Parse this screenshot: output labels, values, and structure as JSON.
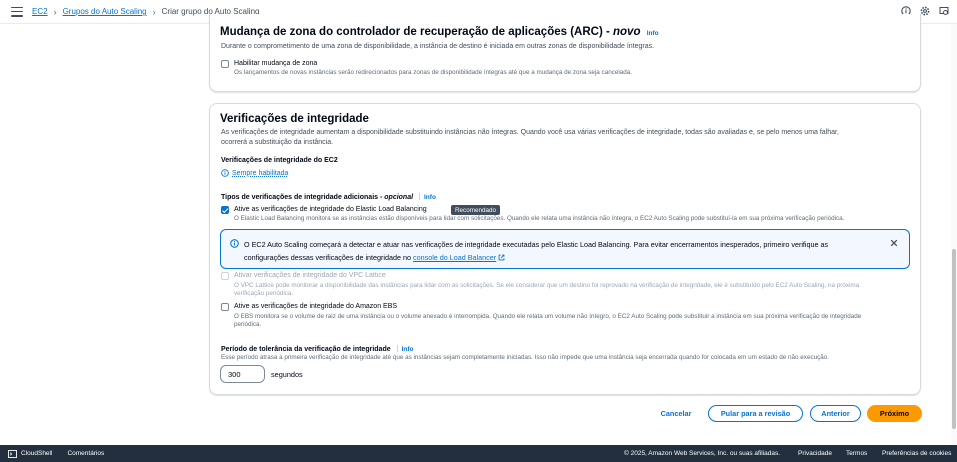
{
  "header": {
    "breadcrumbs": [
      "EC2",
      "Grupos do Auto Scaling"
    ],
    "current": "Criar grupo do Auto Scaling"
  },
  "arc": {
    "title": "Mudança de zona do controlador de recuperação de aplicações (ARC) - ",
    "title_suffix": "novo",
    "info": "Info",
    "description": "Durante o comprometimento de uma zona de disponibilidade, a instância de destino é iniciada em outras zonas de disponibilidade íntegras.",
    "checkbox_label": "Habilitar mudança de zona",
    "checkbox_checked": false,
    "checkbox_help": "Os lançamentos de novas instâncias serão redirecionados para zonas de disponibilidade íntegras até que a mudança de zona seja cancelada."
  },
  "health": {
    "title": "Verificações de integridade",
    "description_1": "As verificações de integridade aumentam a disponibilidade substituindo instâncias não íntegras. Quando você usa várias verificações de integridade, todas são avaliadas e, se pelo menos uma falhar,",
    "description_2": "ocorrerá a substituição da instância.",
    "ec2_label": "Verificações de integridade do EC2",
    "ec2_value": "Sempre habilitada",
    "extra_label": "Tipos de verificações de integridade adicionais - ",
    "extra_optional": "opcional",
    "info": "Info",
    "elb": {
      "label": "Ative as verificações de integridade do Elastic Load Balancing",
      "badge": "Recomendado",
      "checked": true,
      "help": "O Elastic Load Balancing monitora se as instâncias estão disponíveis para lidar com solicitações. Quando ele relata uma instância não íntegra, o EC2 Auto Scaling pode substituí-la em sua próxima verificação periódica."
    },
    "alert": {
      "text_1": "O EC2 Auto Scaling começará a detectar e atuar nas verificações de integridade executadas pelo Elastic Load Balancing. Para evitar encerramentos inesperados, primeiro verifique as",
      "text_2": "configurações dessas verificações de integridade no ",
      "link": "console do Load Balancer"
    },
    "vpc": {
      "label": "Ativar verificações de integridade do VPC Lattice",
      "help_1": "O VPC Lattice pode monitorar a disponibilidade das instâncias para lidar com as solicitações. Se ele considerar que um destino foi reprovado na verificação de integridade, ele é substituído pelo EC2 Auto Scaling, na próxima",
      "help_2": "verificação periódica."
    },
    "ebs": {
      "label": "Ative as verificações de integridade do Amazon EBS",
      "checked": false,
      "help_1": "O EBS monitora se o volume de raiz de uma instância ou o volume anexado é interrompida. Quando ele relata um volume não íntegro, o EC2 Auto Scaling pode substituir a instância em sua próxima verificação de integridade",
      "help_2": "periódica."
    },
    "grace": {
      "label": "Período de tolerância da verificação de integridade",
      "info": "Info",
      "help": "Esse período atrasa a primeira verificação de integridade até que as instâncias sejam completamente iniciadas. Isso não impede que uma instância seja encerrada quando for colocada em um estado de não execução.",
      "value": "300",
      "unit": "segundos"
    }
  },
  "actions": {
    "cancel": "Cancelar",
    "skip": "Pular para a revisão",
    "previous": "Anterior",
    "next": "Próximo"
  },
  "footer": {
    "cloudshell": "CloudShell",
    "feedback": "Comentários",
    "copyright": "© 2025, Amazon Web Services, Inc. ou suas afiliadas.",
    "privacy": "Privacidade",
    "terms": "Termos",
    "cookies": "Preferências de cookies"
  },
  "colors": {
    "link": "#0972d3",
    "primary": "#ff9900",
    "footer_bg": "#232f3e"
  },
  "icons": [
    "menu-icon",
    "info-circle-icon",
    "settings-icon",
    "notifications-icon",
    "clock-icon",
    "external-link-icon",
    "close-icon",
    "cloudshell-icon"
  ]
}
